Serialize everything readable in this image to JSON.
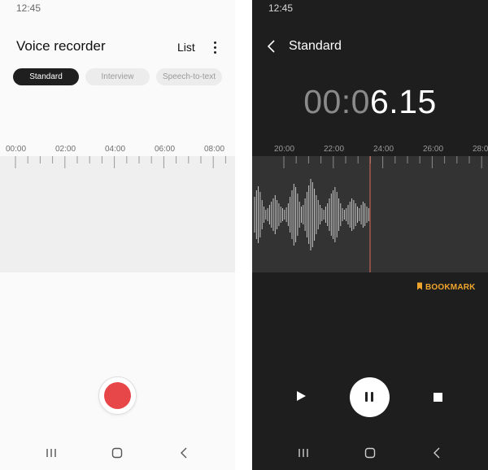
{
  "left_screen": {
    "status_time": "12:45",
    "title": "Voice recorder",
    "list_label": "List",
    "mode_tabs": [
      {
        "label": "Standard",
        "active": true
      },
      {
        "label": "Interview",
        "active": false
      },
      {
        "label": "Speech-to-text",
        "active": false
      }
    ],
    "timeline_labels": [
      "00:00",
      "02:00",
      "04:00",
      "06:00",
      "08:00"
    ],
    "record_color": "#e8474a"
  },
  "right_screen": {
    "status_time": "12:45",
    "title": "Standard",
    "elapsed_dim": "00:0",
    "elapsed_bright": "6.15",
    "timeline_labels": [
      "20:00",
      "22:00",
      "24:00",
      "26:00",
      "28:0"
    ],
    "bookmark_label": "BOOKMARK",
    "accent": "#f0a52d",
    "playhead_color": "#e06a5a"
  },
  "icons": {
    "menu": "kebab-menu-icon",
    "back": "back-arrow-icon",
    "bookmark": "bookmark-icon",
    "play": "play-icon",
    "pause": "pause-icon",
    "stop": "stop-icon",
    "nav_recents": "recents-icon",
    "nav_home": "home-icon",
    "nav_back": "nav-back-icon"
  }
}
